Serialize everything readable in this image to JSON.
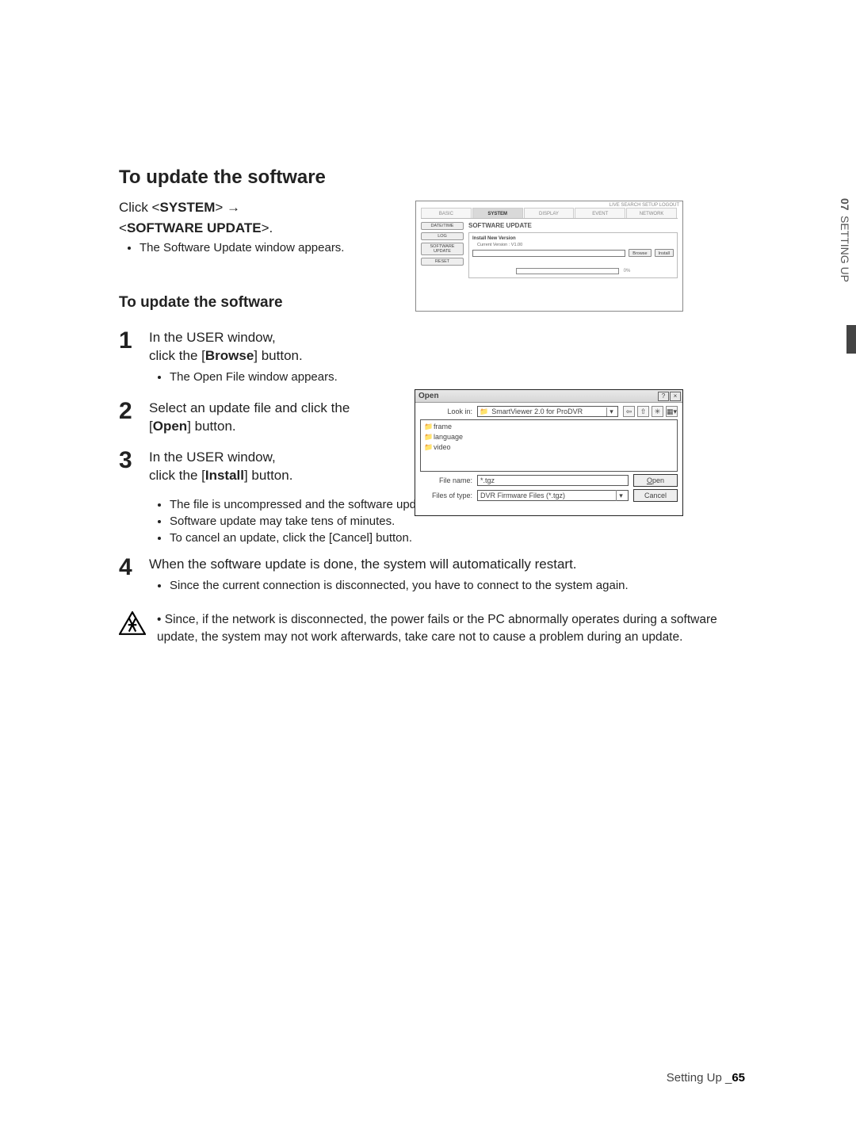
{
  "sideTab": {
    "num": "07",
    "label": "SETTING UP"
  },
  "section": {
    "title": "To update the software",
    "intro1_pre": "Click <",
    "intro1_bold": "SYSTEM",
    "intro1_post": "> →",
    "intro2_pre": "<",
    "intro2_bold": "SOFTWARE UPDATE",
    "intro2_post": ">.",
    "intro_bullet": "The Software Update window appears."
  },
  "figUpdate": {
    "topLinks": "LIVE SEARCH SETUP LOGOUT",
    "tabs": [
      "BASIC",
      "SYSTEM",
      "DISPLAY",
      "EVENT",
      "NETWORK"
    ],
    "activeTab": 1,
    "sideButtons": [
      "DATE/TIME",
      "LOG",
      "SOFTWARE UPDATE",
      "RESET"
    ],
    "panelTitle": "SOFTWARE UPDATE",
    "installLabel": "Install New Version",
    "currentVersion": "Current Version : V1.00",
    "browse": "Browse",
    "install": "Install",
    "progress": "0%"
  },
  "subhead": "To update the software",
  "steps": [
    {
      "n": "1",
      "lead_a": "In the USER window,",
      "lead_b_pre": "click the [",
      "lead_b_bold": "Browse",
      "lead_b_post": "] button.",
      "bullets": [
        "The Open File window appears."
      ]
    },
    {
      "n": "2",
      "lead_a": "Select an update file and click the",
      "lead_b_pre": "[",
      "lead_b_bold": "Open",
      "lead_b_post": "] button.",
      "bullets": []
    },
    {
      "n": "3",
      "lead_a": "In the USER window,",
      "lead_b_pre": "click the [",
      "lead_b_bold": "Install",
      "lead_b_post": "] button.",
      "bullets": [
        "The file is uncompressed and the software update begins.",
        "Software update may take tens of minutes.",
        "To cancel an update, click the [Cancel] button."
      ]
    },
    {
      "n": "4",
      "lead_a": "When the software update is done, the system will automatically restart.",
      "lead_b_pre": "",
      "lead_b_bold": "",
      "lead_b_post": "",
      "bullets": [
        "Since the current connection is disconnected, you have to connect to the system again."
      ]
    }
  ],
  "openDlg": {
    "caption": "Open",
    "lookInLabel": "Look in:",
    "lookInValue": "SmartViewer 2.0 for ProDVR",
    "folders": [
      "frame",
      "language",
      "video"
    ],
    "fileNameLabel": "File name:",
    "fileNameValue": "*.tgz",
    "fileTypeLabel": "Files of type:",
    "fileTypeValue": "DVR Firmware Files (*.tgz)",
    "openBtn": "Open",
    "cancelBtn": "Cancel"
  },
  "caution": "Since, if the network is disconnected, the power fails or the PC abnormally operates during a software update, the system may not work afterwards, take care not to cause a problem during an update.",
  "footer": {
    "section": "Setting Up _",
    "page": "65"
  }
}
